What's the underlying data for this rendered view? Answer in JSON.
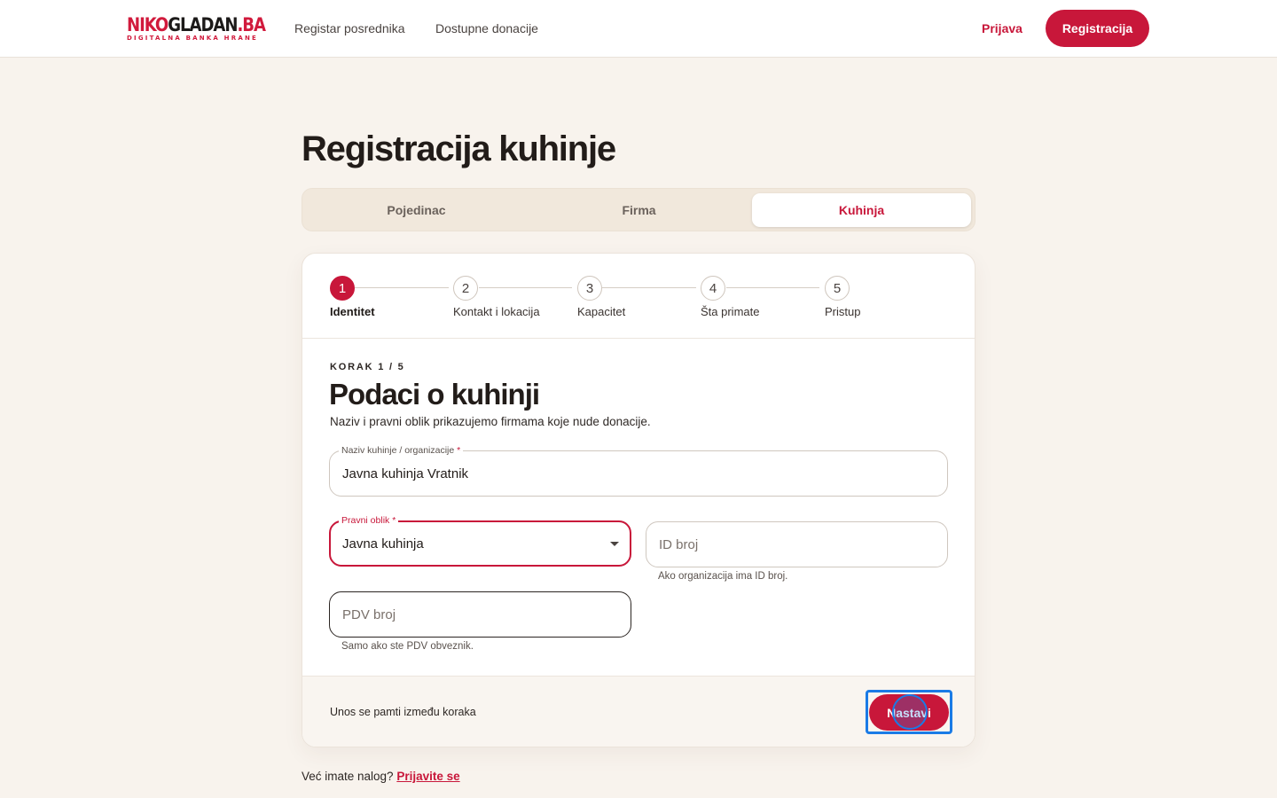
{
  "header": {
    "logo_part1": "NIKO",
    "logo_part2": "GLADAN",
    "logo_part3": ".BA",
    "logo_tagline": "DIGITALNA BANKA HRANE",
    "nav": [
      "Registar posrednika",
      "Dostupne donacije"
    ],
    "login_label": "Prijava",
    "register_label": "Registracija"
  },
  "page": {
    "title": "Registracija kuhinje"
  },
  "tabs": [
    {
      "label": "Pojedinac",
      "active": false
    },
    {
      "label": "Firma",
      "active": false
    },
    {
      "label": "Kuhinja",
      "active": true
    }
  ],
  "stepper": [
    {
      "number": "1",
      "label": "Identitet",
      "active": true
    },
    {
      "number": "2",
      "label": "Kontakt i lokacija",
      "active": false
    },
    {
      "number": "3",
      "label": "Kapacitet",
      "active": false
    },
    {
      "number": "4",
      "label": "Šta primate",
      "active": false
    },
    {
      "number": "5",
      "label": "Pristup",
      "active": false
    }
  ],
  "form": {
    "step_count": "KORAK 1 / 5",
    "title": "Podaci o kuhinji",
    "description": "Naziv i pravni oblik prikazujemo firmama koje nude donacije.",
    "name_label": "Naziv kuhinje / organizacije",
    "name_value": "Javna kuhinja Vratnik",
    "legal_form_label": "Pravni oblik",
    "legal_form_value": "Javna kuhinja",
    "required_mark": "*",
    "id_placeholder": "ID broj",
    "id_helper": "Ako organizacija ima ID broj.",
    "pdv_placeholder": "PDV broj",
    "pdv_helper": "Samo ako ste PDV obveznik."
  },
  "footer": {
    "note": "Unos se pamti između koraka",
    "continue_label": "Nastavi"
  },
  "login_prompt": {
    "text": "Već imate nalog?",
    "link": "Prijavite se"
  },
  "colors": {
    "accent": "#c8173a",
    "background": "#f8f3ed",
    "focus_outline": "#1a7be6"
  }
}
